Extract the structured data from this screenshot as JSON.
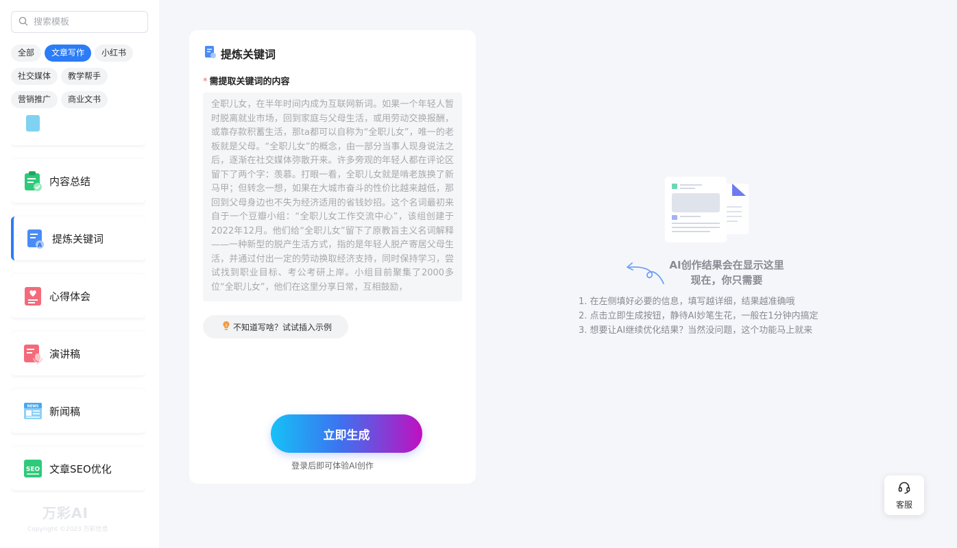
{
  "sidebar": {
    "search": {
      "placeholder": "搜索模板",
      "icon": "search-icon"
    },
    "tags": [
      {
        "label": "全部",
        "active": false
      },
      {
        "label": "文章写作",
        "active": true
      },
      {
        "label": "小红书",
        "active": false
      },
      {
        "label": "社交媒体",
        "active": false
      },
      {
        "label": "教学帮手",
        "active": false
      },
      {
        "label": "营销推广",
        "active": false
      },
      {
        "label": "商业文书",
        "active": false
      }
    ],
    "tools": [
      {
        "label": "内容总结",
        "icon": "clipboard-check-icon",
        "color": "#2fc97a"
      },
      {
        "label": "提炼关键词",
        "icon": "keyword-document-icon",
        "color": "#4a8cf6",
        "active": true
      },
      {
        "label": "心得体会",
        "icon": "heart-note-icon",
        "color": "#f46a7a"
      },
      {
        "label": "演讲稿",
        "icon": "microphone-note-icon",
        "color": "#f46a7a"
      },
      {
        "label": "新闻稿",
        "icon": "newspaper-icon",
        "color": "#4aa8f0"
      },
      {
        "label": "文章SEO优化",
        "icon": "seo-icon",
        "color": "#2fc97a"
      }
    ],
    "brand": "万彩AI",
    "copyright": "Copyright ©2023 万彩信息"
  },
  "form": {
    "title": "提炼关键词",
    "field_label": "需提取关键词的内容",
    "content": "全职儿女，在半年时间内成为互联网新词。如果一个年轻人暂时脱离就业市场，回到家庭与父母生活，或用劳动交换报酬，或靠存款积蓄生活，那ta都可以自称为“全职儿女”，唯一的老板就是父母。“全职儿女”的概念，由一部分当事人现身说法之后，逐渐在社交媒体弥散开来。许多旁观的年轻人都在评论区留下了两个字：羡慕。打眼一看，全职儿女就是啃老族换了新马甲；但转念一想，如果在大城市奋斗的性价比越来越低，那回到父母身边也不失为经济适用的省钱妙招。这个名词最初来自于一个豆瓣小组：“全职儿女工作交流中心”，该组创建于2022年12月。他们给“全职儿女”留下了原教旨主义名词解释——一种新型的脱产生活方式，指的是年轻人脱产寄居父母生活，并通过付出一定的劳动换取经济支持，同时保持学习，尝试找到职业目标、考公考研上岸。小组目前聚集了2000多位“全职儿女”，他们在这里分享日常，互相鼓励，",
    "hint": "不知道写啥？试试插入示例",
    "generate": "立即生成",
    "login_note": "登录后即可体验AI创作"
  },
  "result": {
    "title_line1": "AI创作结果会在显示这里",
    "title_line2": "现在，你只需要",
    "steps": [
      "1. 在左侧填好必要的信息，填写越详细，结果越准确哦",
      "2. 点击立即生成按钮，静待AI妙笔生花，一般在1分钟内搞定",
      "3. 想要让AI继续优化结果？当然没问题，这个功能马上就来"
    ]
  },
  "service": {
    "label": "客服",
    "icon": "headset-icon"
  }
}
